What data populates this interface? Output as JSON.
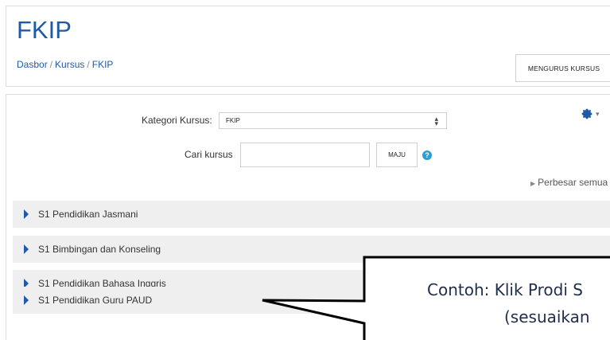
{
  "header": {
    "title": "FKIP",
    "breadcrumb": [
      "Dasbor",
      "Kursus",
      "FKIP"
    ],
    "manage_button": "MENGURUS KURSUS"
  },
  "filter": {
    "category_label": "Kategori Kursus:",
    "category_value": "FKIP",
    "search_label": "Cari kursus",
    "search_value": "",
    "go_button": "MAJU"
  },
  "expand_all": "Perbesar semua",
  "categories": [
    {
      "label": "S1 Pendidikan Jasmani"
    },
    {
      "label": "S1 Bimbingan dan Konseling"
    },
    {
      "label": "S1 Pendidikan Bahasa Inggris"
    },
    {
      "label": "S1 Pendidikan Guru PAUD"
    }
  ],
  "callout": {
    "line1": "Contoh: Klik Prodi S",
    "line2": "(sesuaikan"
  },
  "colors": {
    "link": "#1f5aa6",
    "row_bg": "#efefef",
    "help": "#2a9fd6"
  }
}
